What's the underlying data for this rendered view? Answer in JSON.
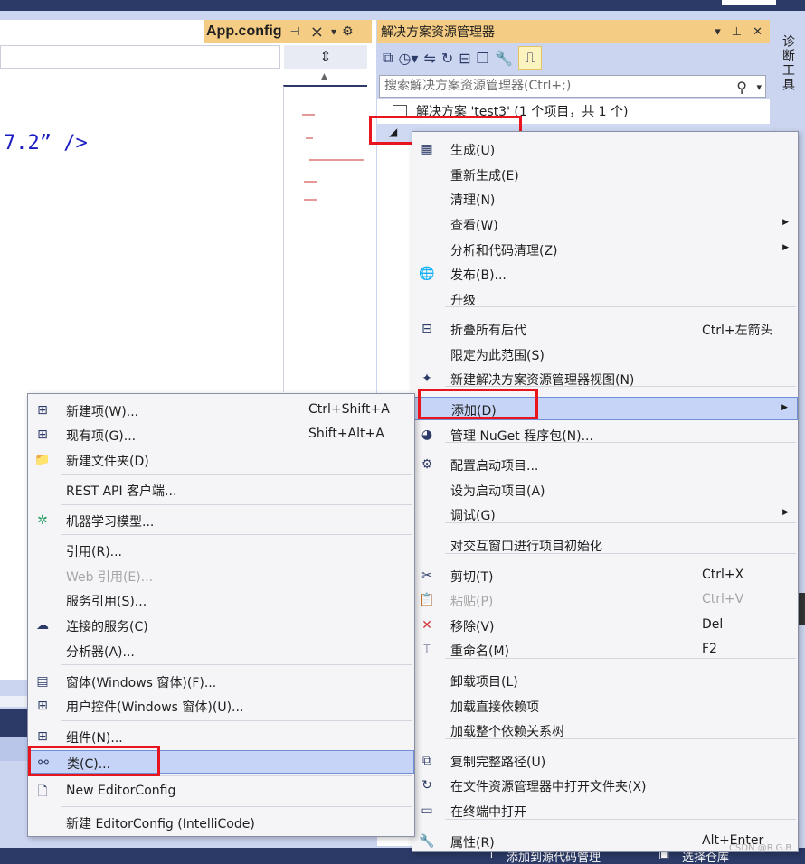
{
  "editor": {
    "tab_title": "App.config",
    "code_text": "7.2” />"
  },
  "solution_explorer": {
    "title": "解决方案资源管理器",
    "search_placeholder": "搜索解决方案资源管理器(Ctrl+;)",
    "solution_node": "解决方案 'test3' (1 个项目，共 1 个)"
  },
  "side_tab": {
    "label": "诊断工具"
  },
  "context_menu": {
    "items": [
      {
        "label": "生成(U)",
        "shortcut": "",
        "icon": "build-icon",
        "submenu": false
      },
      {
        "label": "重新生成(E)",
        "shortcut": "",
        "icon": "",
        "submenu": false
      },
      {
        "label": "清理(N)",
        "shortcut": "",
        "icon": "",
        "submenu": false
      },
      {
        "label": "查看(W)",
        "shortcut": "",
        "icon": "",
        "submenu": true
      },
      {
        "label": "分析和代码清理(Z)",
        "shortcut": "",
        "icon": "",
        "submenu": true
      },
      {
        "label": "发布(B)...",
        "shortcut": "",
        "icon": "globe-icon",
        "submenu": false
      },
      {
        "label": "升级",
        "shortcut": "",
        "icon": "",
        "submenu": false
      },
      {
        "label": "折叠所有后代",
        "shortcut": "Ctrl+左箭头",
        "icon": "collapse-icon",
        "submenu": false
      },
      {
        "label": "限定为此范围(S)",
        "shortcut": "",
        "icon": "",
        "submenu": false
      },
      {
        "label": "新建解决方案资源管理器视图(N)",
        "shortcut": "",
        "icon": "new-view-icon",
        "submenu": false
      },
      {
        "label": "添加(D)",
        "shortcut": "",
        "icon": "",
        "submenu": true
      },
      {
        "label": "管理 NuGet 程序包(N)...",
        "shortcut": "",
        "icon": "nuget-icon",
        "submenu": false
      },
      {
        "label": "配置启动项目...",
        "shortcut": "",
        "icon": "gear-icon",
        "submenu": false
      },
      {
        "label": "设为启动项目(A)",
        "shortcut": "",
        "icon": "",
        "submenu": false
      },
      {
        "label": "调试(G)",
        "shortcut": "",
        "icon": "",
        "submenu": true
      },
      {
        "label": "对交互窗口进行项目初始化",
        "shortcut": "",
        "icon": "",
        "submenu": false
      },
      {
        "label": "剪切(T)",
        "shortcut": "Ctrl+X",
        "icon": "scissors-icon",
        "submenu": false
      },
      {
        "label": "粘贴(P)",
        "shortcut": "Ctrl+V",
        "icon": "paste-icon",
        "submenu": false
      },
      {
        "label": "移除(V)",
        "shortcut": "Del",
        "icon": "remove-icon",
        "submenu": false
      },
      {
        "label": "重命名(M)",
        "shortcut": "F2",
        "icon": "rename-icon",
        "submenu": false
      },
      {
        "label": "卸载项目(L)",
        "shortcut": "",
        "icon": "",
        "submenu": false
      },
      {
        "label": "加载直接依赖项",
        "shortcut": "",
        "icon": "",
        "submenu": false
      },
      {
        "label": "加载整个依赖关系树",
        "shortcut": "",
        "icon": "",
        "submenu": false
      },
      {
        "label": "复制完整路径(U)",
        "shortcut": "",
        "icon": "copy-icon",
        "submenu": false
      },
      {
        "label": "在文件资源管理器中打开文件夹(X)",
        "shortcut": "",
        "icon": "refresh-icon",
        "submenu": false
      },
      {
        "label": "在终端中打开",
        "shortcut": "",
        "icon": "terminal-icon",
        "submenu": false
      },
      {
        "label": "属性(R)",
        "shortcut": "Alt+Enter",
        "icon": "wrench-icon",
        "submenu": false
      }
    ]
  },
  "add_submenu": {
    "items": [
      {
        "label": "新建项(W)...",
        "shortcut": "Ctrl+Shift+A"
      },
      {
        "label": "现有项(G)...",
        "shortcut": "Shift+Alt+A"
      },
      {
        "label": "新建文件夹(D)",
        "shortcut": ""
      },
      {
        "label": "REST API 客户端...",
        "shortcut": ""
      },
      {
        "label": "机器学习模型...",
        "shortcut": ""
      },
      {
        "label": "引用(R)...",
        "shortcut": ""
      },
      {
        "label": "Web 引用(E)...",
        "shortcut": ""
      },
      {
        "label": "服务引用(S)...",
        "shortcut": ""
      },
      {
        "label": "连接的服务(C)",
        "shortcut": ""
      },
      {
        "label": "分析器(A)...",
        "shortcut": ""
      },
      {
        "label": "窗体(Windows 窗体)(F)...",
        "shortcut": ""
      },
      {
        "label": "用户控件(Windows 窗体)(U)...",
        "shortcut": ""
      },
      {
        "label": "组件(N)...",
        "shortcut": ""
      },
      {
        "label": "类(C)...",
        "shortcut": ""
      },
      {
        "label": "New EditorConfig",
        "shortcut": ""
      },
      {
        "label": "新建 EditorConfig (IntelliCode)",
        "shortcut": ""
      }
    ]
  },
  "status_bar": {
    "add_source_control": "添加到源代码管理",
    "select_repo": "选择仓库"
  },
  "watermark": "CSDN @R.G.B",
  "colors": {
    "accent_tab": "#f5cc84",
    "highlight_box": "#e8141e",
    "selection": "#c6d4f7",
    "navy": "#2b3a67"
  }
}
